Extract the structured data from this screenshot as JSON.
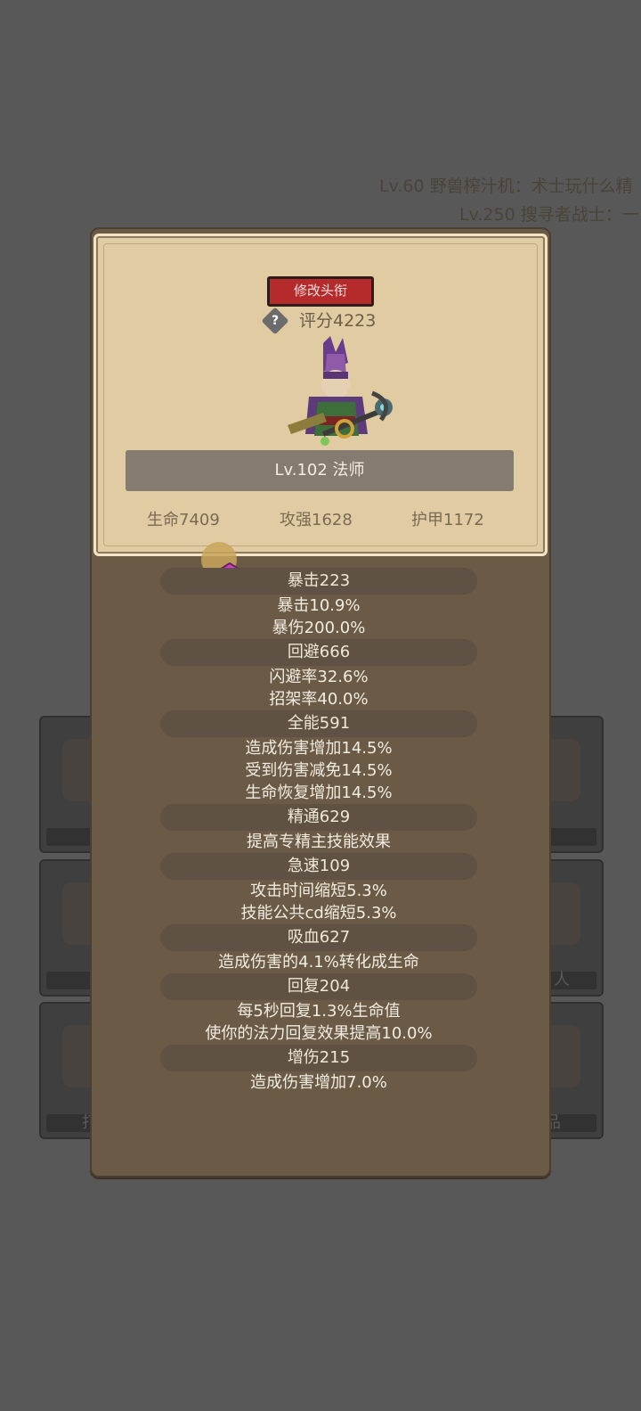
{
  "ticker": [
    "Lv.60 野兽榨汁机：术士玩什么精",
    "Lv.250 搜寻者战士：一"
  ],
  "background_cards": [
    {
      "label": ""
    },
    {
      "label": ""
    },
    {
      "label": "人"
    },
    {
      "label": "打"
    },
    {
      "label": "品"
    }
  ],
  "profile": {
    "rename_label": "修改头衔",
    "help_glyph": "?",
    "score": "评分4223",
    "name": "Lv.102 法师",
    "hp": "生命7409",
    "attack": "攻强1628",
    "armor": "护甲1172"
  },
  "stats": [
    {
      "head": "暴击223",
      "lines": [
        "暴击10.9%",
        "暴伤200.0%"
      ]
    },
    {
      "head": "回避666",
      "lines": [
        "闪避率32.6%",
        "招架率40.0%"
      ]
    },
    {
      "head": "全能591",
      "lines": [
        "造成伤害增加14.5%",
        "受到伤害减免14.5%",
        "生命恢复增加14.5%"
      ]
    },
    {
      "head": "精通629",
      "lines": [
        "提高专精主技能效果"
      ]
    },
    {
      "head": "急速109",
      "lines": [
        "攻击时间缩短5.3%",
        "技能公共cd缩短5.3%"
      ]
    },
    {
      "head": "吸血627",
      "lines": [
        "造成伤害的4.1%转化成生命"
      ]
    },
    {
      "head": "回复204",
      "lines": [
        "每5秒回复1.3%生命值",
        "使你的法力回复效果提高10.0%"
      ]
    },
    {
      "head": "增伤215",
      "lines": [
        "造成伤害增加7.0%"
      ]
    }
  ]
}
